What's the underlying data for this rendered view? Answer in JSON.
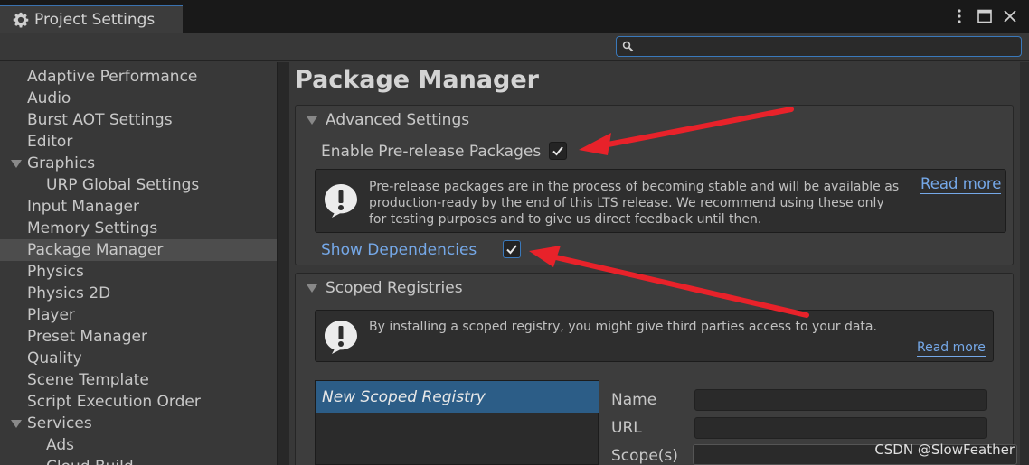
{
  "window": {
    "tab_title": "Project Settings"
  },
  "search": {
    "placeholder": ""
  },
  "sidebar": {
    "items": [
      {
        "label": "Adaptive Performance"
      },
      {
        "label": "Audio"
      },
      {
        "label": "Burst AOT Settings"
      },
      {
        "label": "Editor"
      },
      {
        "label": "Graphics",
        "foldout": true
      },
      {
        "label": "URP Global Settings",
        "child": true
      },
      {
        "label": "Input Manager"
      },
      {
        "label": "Memory Settings"
      },
      {
        "label": "Package Manager",
        "selected": true
      },
      {
        "label": "Physics"
      },
      {
        "label": "Physics 2D"
      },
      {
        "label": "Player"
      },
      {
        "label": "Preset Manager"
      },
      {
        "label": "Quality"
      },
      {
        "label": "Scene Template"
      },
      {
        "label": "Script Execution Order"
      },
      {
        "label": "Services",
        "foldout": true
      },
      {
        "label": "Ads",
        "child": true
      },
      {
        "label": "Cloud Build",
        "child": true
      }
    ]
  },
  "main": {
    "title": "Package Manager",
    "advanced": {
      "header": "Advanced Settings",
      "prerelease_label": "Enable Pre-release Packages",
      "prerelease_checked": true,
      "help_line1": "Pre-release packages are in the process of becoming stable and will be available as",
      "help_line2": "production-ready by the end of this LTS release. We recommend using these only",
      "help_line3": "for testing purposes and to give us direct feedback until then.",
      "read_more": "Read more",
      "show_deps_label": "Show Dependencies",
      "show_deps_checked": true
    },
    "scoped": {
      "header": "Scoped Registries",
      "help_text": "By installing a scoped registry, you might give third parties access to your data.",
      "read_more": "Read more",
      "registries": [
        "New Scoped Registry"
      ],
      "fields": {
        "name": "Name",
        "url": "URL",
        "scopes": "Scope(s)"
      }
    }
  },
  "watermark": "CSDN @SlowFeather",
  "colors": {
    "accent": "#3a79bb",
    "selection": "#2c5d87",
    "link": "#75a8e8",
    "annotation": "#e8222a"
  }
}
